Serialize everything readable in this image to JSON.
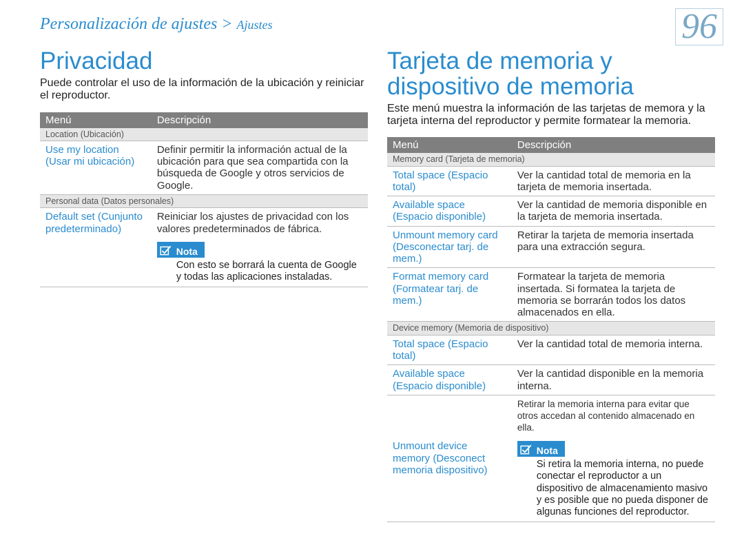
{
  "breadcrumb": {
    "main": "Personalización de ajustes",
    "sep": ">",
    "sub": "Ajustes"
  },
  "pageNumber": "96",
  "left": {
    "title": "Privacidad",
    "intro": "Puede controlar el uso de la información de la ubicación y reiniciar el reproductor.",
    "headers": {
      "menu": "Menú",
      "desc": "Descripción"
    },
    "cat1": "Location (Ubicación)",
    "row1": {
      "menu": "Use my location (Usar mi ubicación)",
      "desc": "Definir permitir la información actual de la ubicación para que sea compartida con la búsqueda de Google y otros servicios de Google."
    },
    "cat2": "Personal data (Datos personales)",
    "row2": {
      "menu": "Default set (Cunjunto predeterminado)",
      "desc": "Reiniciar los ajustes de privacidad con los valores predeterminados de fábrica.",
      "notaLabel": "Nota",
      "notaText": "Con esto se borrará la cuenta de Google y todas las aplicaciones instaladas."
    }
  },
  "right": {
    "title": "Tarjeta de memoria y dispositivo de memoria",
    "intro": "Este menú muestra la información de las tarjetas de memora y la tarjeta interna del reproductor y permite formatear la memoria.",
    "headers": {
      "menu": "Menú",
      "desc": "Descripción"
    },
    "cat1": "Memory card (Tarjeta de memoria)",
    "r1": {
      "menu": "Total space (Espacio total)",
      "desc": "Ver la cantidad total de memoria en la tarjeta de memoria insertada."
    },
    "r2": {
      "menu": "Available space (Espacio disponible)",
      "desc": "Ver la cantidad de memoria disponible en la tarjeta de memoria insertada."
    },
    "r3": {
      "menu": "Unmount memory card (Desconectar tarj. de mem.)",
      "desc": "Retirar la tarjeta de memoria insertada para una extracción segura."
    },
    "r4": {
      "menu": "Format memory card (Formatear tarj. de mem.)",
      "desc": "Formatear la tarjeta de memoria insertada. Si formatea la tarjeta de memoria se borrarán todos los datos almacenados en ella."
    },
    "cat2": "Device memory (Memoria de dispositivo)",
    "r5": {
      "menu": "Total space (Espacio total)",
      "desc": "Ver la cantidad total de memoria interna."
    },
    "r6": {
      "menu": "Available space (Espacio disponible)",
      "desc": "Ver la cantidad disponible en la memoria interna."
    },
    "r7": {
      "menu": "Unmount device memory (Desconect memoria dispositivo)",
      "desc": "Retirar la memoria interna para evitar que otros accedan al contenido almacenado en ella.",
      "notaLabel": "Nota",
      "notaText": "Si retira la memoria interna, no puede conectar el reproductor a un dispositivo de almacenamiento masivo y es posible que no pueda disponer de algunas funciones del reproductor."
    }
  }
}
